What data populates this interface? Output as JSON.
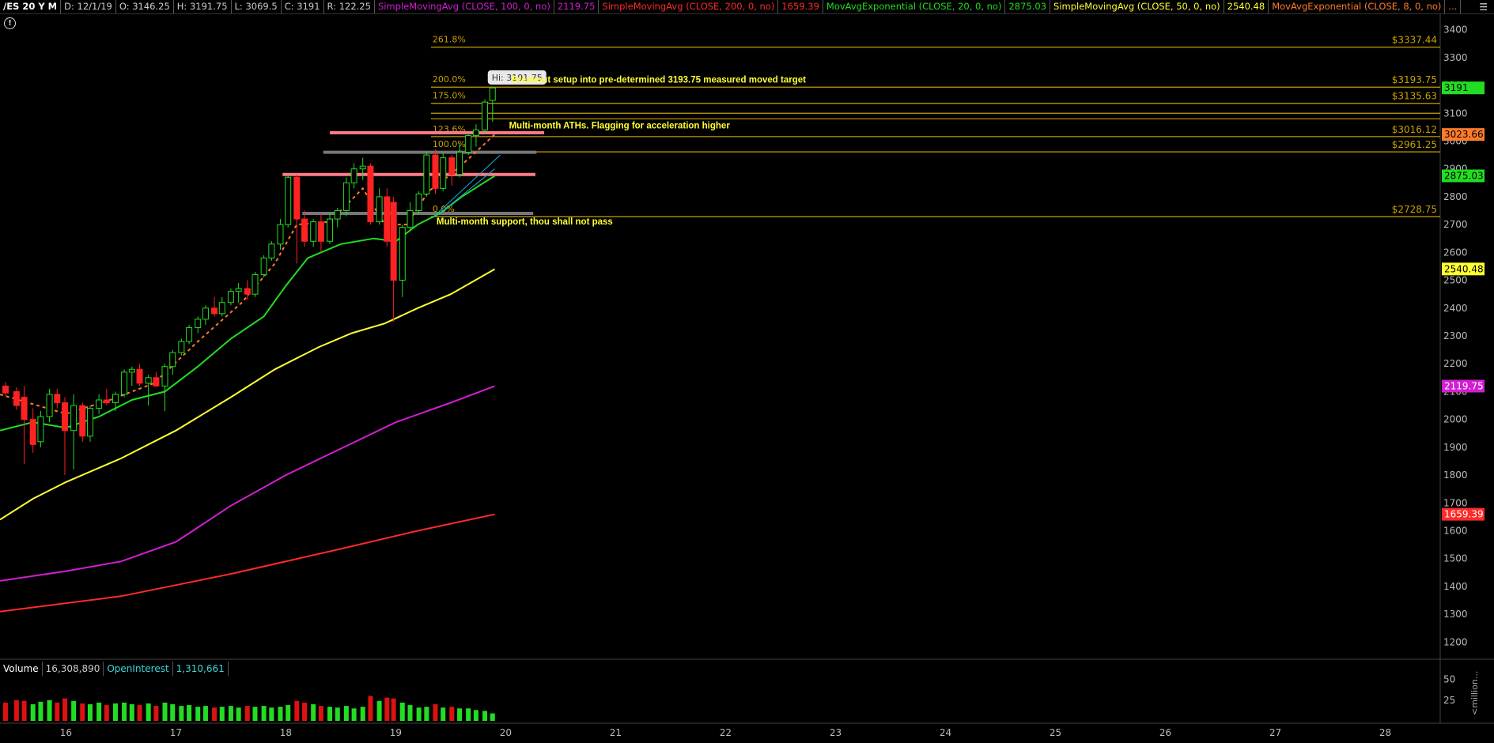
{
  "header": {
    "symbol": "/ES 20 Y M",
    "date": "D: 12/1/19",
    "open": "O: 3146.25",
    "high": "H: 3191.75",
    "low": "L: 3069.5",
    "close": "C: 3191",
    "range": "R: 122.25",
    "studies": [
      {
        "label": "SimpleMovingAvg (CLOSE, 100, 0, no)",
        "value": "2119.75",
        "color": "#d21fd2"
      },
      {
        "label": "SimpleMovingAvg (CLOSE, 200, 0, no)",
        "value": "1659.39",
        "color": "#ff2a2a"
      },
      {
        "label": "MovAvgExponential (CLOSE, 20, 0, no)",
        "value": "2875.03",
        "color": "#22dd22"
      },
      {
        "label": "SimpleMovingAvg (CLOSE, 50, 0, no)",
        "value": "2540.48",
        "color": "#ffff33"
      },
      {
        "label": "MovAvgExponential (CLOSE, 8, 0, no)",
        "value": "...",
        "color": "#ff7b2a"
      }
    ]
  },
  "icons": {
    "alert": "alert-circle-icon",
    "menu": "menu-icon"
  },
  "volume_header": {
    "volume_label": "Volume",
    "volume_value": "16,308,890",
    "oi_label": "OpenInterest",
    "oi_value": "1,310,661",
    "unit_label": "<million..."
  },
  "chart_data": {
    "type": "candlestick",
    "x_ticks": [
      "16",
      "17",
      "18",
      "19",
      "20",
      "21",
      "22",
      "23",
      "24",
      "25",
      "26",
      "27",
      "28"
    ],
    "y_ticks": [
      1200,
      1300,
      1400,
      1500,
      1600,
      1700,
      1800,
      1900,
      2000,
      2100,
      2200,
      2300,
      2400,
      2500,
      2600,
      2700,
      2800,
      2900,
      3000,
      3100,
      3200,
      3300,
      3400
    ],
    "ylim": [
      1150,
      3450
    ],
    "x_year_range": [
      15.4,
      28.5
    ],
    "volume_ticks": [
      25,
      50
    ],
    "hi_label": "Hi: 3191.75",
    "candles": [
      {
        "x": 15.45,
        "o": 2120,
        "h": 2135,
        "l": 2085,
        "c": 2095
      },
      {
        "x": 15.55,
        "o": 2100,
        "h": 2115,
        "l": 2035,
        "c": 2050
      },
      {
        "x": 15.62,
        "o": 2080,
        "h": 2120,
        "l": 1840,
        "c": 2000
      },
      {
        "x": 15.7,
        "o": 2000,
        "h": 2040,
        "l": 1880,
        "c": 1910
      },
      {
        "x": 15.77,
        "o": 1920,
        "h": 2030,
        "l": 1900,
        "c": 2010
      },
      {
        "x": 15.85,
        "o": 2010,
        "h": 2110,
        "l": 1990,
        "c": 2090
      },
      {
        "x": 15.92,
        "o": 2090,
        "h": 2110,
        "l": 2040,
        "c": 2060
      },
      {
        "x": 15.99,
        "o": 2060,
        "h": 2080,
        "l": 1800,
        "c": 1960
      },
      {
        "x": 16.07,
        "o": 1960,
        "h": 2090,
        "l": 1820,
        "c": 2050
      },
      {
        "x": 16.15,
        "o": 2050,
        "h": 2060,
        "l": 1920,
        "c": 1940
      },
      {
        "x": 16.22,
        "o": 1940,
        "h": 2050,
        "l": 1920,
        "c": 2040
      },
      {
        "x": 16.3,
        "o": 2040,
        "h": 2090,
        "l": 2020,
        "c": 2070
      },
      {
        "x": 16.37,
        "o": 2070,
        "h": 2110,
        "l": 2050,
        "c": 2060
      },
      {
        "x": 16.45,
        "o": 2060,
        "h": 2100,
        "l": 2030,
        "c": 2090
      },
      {
        "x": 16.53,
        "o": 2090,
        "h": 2180,
        "l": 2080,
        "c": 2170
      },
      {
        "x": 16.6,
        "o": 2170,
        "h": 2190,
        "l": 2120,
        "c": 2180
      },
      {
        "x": 16.67,
        "o": 2180,
        "h": 2200,
        "l": 2120,
        "c": 2130
      },
      {
        "x": 16.75,
        "o": 2130,
        "h": 2160,
        "l": 2050,
        "c": 2150
      },
      {
        "x": 16.82,
        "o": 2150,
        "h": 2170,
        "l": 2120,
        "c": 2120
      },
      {
        "x": 16.9,
        "o": 2120,
        "h": 2200,
        "l": 2030,
        "c": 2190
      },
      {
        "x": 16.97,
        "o": 2190,
        "h": 2250,
        "l": 2160,
        "c": 2240
      },
      {
        "x": 17.05,
        "o": 2240,
        "h": 2290,
        "l": 2230,
        "c": 2280
      },
      {
        "x": 17.12,
        "o": 2280,
        "h": 2340,
        "l": 2270,
        "c": 2330
      },
      {
        "x": 17.2,
        "o": 2330,
        "h": 2370,
        "l": 2310,
        "c": 2360
      },
      {
        "x": 17.27,
        "o": 2360,
        "h": 2410,
        "l": 2340,
        "c": 2400
      },
      {
        "x": 17.35,
        "o": 2400,
        "h": 2440,
        "l": 2370,
        "c": 2380
      },
      {
        "x": 17.42,
        "o": 2380,
        "h": 2440,
        "l": 2370,
        "c": 2420
      },
      {
        "x": 17.5,
        "o": 2420,
        "h": 2470,
        "l": 2410,
        "c": 2460
      },
      {
        "x": 17.57,
        "o": 2460,
        "h": 2490,
        "l": 2420,
        "c": 2470
      },
      {
        "x": 17.65,
        "o": 2470,
        "h": 2500,
        "l": 2430,
        "c": 2450
      },
      {
        "x": 17.72,
        "o": 2450,
        "h": 2530,
        "l": 2440,
        "c": 2520
      },
      {
        "x": 17.8,
        "o": 2520,
        "h": 2590,
        "l": 2510,
        "c": 2580
      },
      {
        "x": 17.87,
        "o": 2580,
        "h": 2640,
        "l": 2570,
        "c": 2630
      },
      {
        "x": 17.95,
        "o": 2630,
        "h": 2720,
        "l": 2610,
        "c": 2700
      },
      {
        "x": 18.02,
        "o": 2700,
        "h": 2880,
        "l": 2690,
        "c": 2870
      },
      {
        "x": 18.1,
        "o": 2870,
        "h": 2880,
        "l": 2560,
        "c": 2720
      },
      {
        "x": 18.17,
        "o": 2720,
        "h": 2750,
        "l": 2620,
        "c": 2640
      },
      {
        "x": 18.25,
        "o": 2640,
        "h": 2720,
        "l": 2620,
        "c": 2710
      },
      {
        "x": 18.32,
        "o": 2710,
        "h": 2740,
        "l": 2600,
        "c": 2640
      },
      {
        "x": 18.4,
        "o": 2640,
        "h": 2740,
        "l": 2630,
        "c": 2720
      },
      {
        "x": 18.47,
        "o": 2720,
        "h": 2760,
        "l": 2690,
        "c": 2750
      },
      {
        "x": 18.55,
        "o": 2750,
        "h": 2870,
        "l": 2730,
        "c": 2850
      },
      {
        "x": 18.62,
        "o": 2850,
        "h": 2920,
        "l": 2830,
        "c": 2900
      },
      {
        "x": 18.7,
        "o": 2900,
        "h": 2940,
        "l": 2860,
        "c": 2910
      },
      {
        "x": 18.77,
        "o": 2910,
        "h": 2920,
        "l": 2700,
        "c": 2710
      },
      {
        "x": 18.85,
        "o": 2710,
        "h": 2830,
        "l": 2700,
        "c": 2800
      },
      {
        "x": 18.92,
        "o": 2800,
        "h": 2830,
        "l": 2620,
        "c": 2640
      },
      {
        "x": 18.98,
        "o": 2780,
        "h": 2800,
        "l": 2350,
        "c": 2500
      },
      {
        "x": 19.06,
        "o": 2500,
        "h": 2700,
        "l": 2440,
        "c": 2690
      },
      {
        "x": 19.13,
        "o": 2690,
        "h": 2780,
        "l": 2680,
        "c": 2750
      },
      {
        "x": 19.21,
        "o": 2750,
        "h": 2820,
        "l": 2740,
        "c": 2810
      },
      {
        "x": 19.28,
        "o": 2810,
        "h": 2960,
        "l": 2800,
        "c": 2950
      },
      {
        "x": 19.36,
        "o": 2950,
        "h": 2970,
        "l": 2810,
        "c": 2830
      },
      {
        "x": 19.43,
        "o": 2830,
        "h": 2960,
        "l": 2820,
        "c": 2940
      },
      {
        "x": 19.51,
        "o": 2940,
        "h": 2950,
        "l": 2840,
        "c": 2880
      },
      {
        "x": 19.58,
        "o": 2880,
        "h": 2990,
        "l": 2870,
        "c": 2960
      },
      {
        "x": 19.66,
        "o": 2960,
        "h": 3030,
        "l": 2950,
        "c": 3020
      },
      {
        "x": 19.73,
        "o": 3020,
        "h": 3060,
        "l": 2980,
        "c": 3040
      },
      {
        "x": 19.81,
        "o": 3040,
        "h": 3150,
        "l": 3030,
        "c": 3140
      },
      {
        "x": 19.88,
        "o": 3146.25,
        "h": 3191.75,
        "l": 3069.5,
        "c": 3191
      }
    ],
    "volume": [
      {
        "x": 15.45,
        "v": 22,
        "up": false
      },
      {
        "x": 15.55,
        "v": 25,
        "up": false
      },
      {
        "x": 15.62,
        "v": 24,
        "up": false
      },
      {
        "x": 15.7,
        "v": 20,
        "up": true
      },
      {
        "x": 15.77,
        "v": 23,
        "up": true
      },
      {
        "x": 15.85,
        "v": 25,
        "up": true
      },
      {
        "x": 15.92,
        "v": 22,
        "up": false
      },
      {
        "x": 15.99,
        "v": 27,
        "up": false
      },
      {
        "x": 16.07,
        "v": 24,
        "up": true
      },
      {
        "x": 16.15,
        "v": 21,
        "up": false
      },
      {
        "x": 16.22,
        "v": 20,
        "up": true
      },
      {
        "x": 16.3,
        "v": 22,
        "up": true
      },
      {
        "x": 16.37,
        "v": 19,
        "up": false
      },
      {
        "x": 16.45,
        "v": 21,
        "up": true
      },
      {
        "x": 16.53,
        "v": 22,
        "up": true
      },
      {
        "x": 16.6,
        "v": 20,
        "up": true
      },
      {
        "x": 16.67,
        "v": 19,
        "up": false
      },
      {
        "x": 16.75,
        "v": 21,
        "up": true
      },
      {
        "x": 16.82,
        "v": 18,
        "up": false
      },
      {
        "x": 16.9,
        "v": 22,
        "up": true
      },
      {
        "x": 16.97,
        "v": 20,
        "up": true
      },
      {
        "x": 17.05,
        "v": 18,
        "up": true
      },
      {
        "x": 17.12,
        "v": 19,
        "up": true
      },
      {
        "x": 17.2,
        "v": 17,
        "up": true
      },
      {
        "x": 17.27,
        "v": 18,
        "up": true
      },
      {
        "x": 17.35,
        "v": 16,
        "up": false
      },
      {
        "x": 17.42,
        "v": 17,
        "up": true
      },
      {
        "x": 17.5,
        "v": 18,
        "up": true
      },
      {
        "x": 17.57,
        "v": 16,
        "up": true
      },
      {
        "x": 17.65,
        "v": 18,
        "up": false
      },
      {
        "x": 17.72,
        "v": 17,
        "up": true
      },
      {
        "x": 17.8,
        "v": 18,
        "up": true
      },
      {
        "x": 17.87,
        "v": 16,
        "up": true
      },
      {
        "x": 17.95,
        "v": 17,
        "up": true
      },
      {
        "x": 18.02,
        "v": 19,
        "up": true
      },
      {
        "x": 18.1,
        "v": 24,
        "up": false
      },
      {
        "x": 18.17,
        "v": 22,
        "up": false
      },
      {
        "x": 18.25,
        "v": 20,
        "up": true
      },
      {
        "x": 18.32,
        "v": 18,
        "up": false
      },
      {
        "x": 18.4,
        "v": 17,
        "up": true
      },
      {
        "x": 18.47,
        "v": 16,
        "up": true
      },
      {
        "x": 18.55,
        "v": 18,
        "up": true
      },
      {
        "x": 18.62,
        "v": 15,
        "up": true
      },
      {
        "x": 18.7,
        "v": 17,
        "up": true
      },
      {
        "x": 18.77,
        "v": 30,
        "up": false
      },
      {
        "x": 18.85,
        "v": 24,
        "up": true
      },
      {
        "x": 18.92,
        "v": 28,
        "up": false
      },
      {
        "x": 18.98,
        "v": 27,
        "up": false
      },
      {
        "x": 19.06,
        "v": 22,
        "up": true
      },
      {
        "x": 19.13,
        "v": 19,
        "up": true
      },
      {
        "x": 19.21,
        "v": 16,
        "up": true
      },
      {
        "x": 19.28,
        "v": 17,
        "up": true
      },
      {
        "x": 19.36,
        "v": 20,
        "up": false
      },
      {
        "x": 19.43,
        "v": 16,
        "up": true
      },
      {
        "x": 19.51,
        "v": 17,
        "up": false
      },
      {
        "x": 19.58,
        "v": 15,
        "up": true
      },
      {
        "x": 19.66,
        "v": 15,
        "up": true
      },
      {
        "x": 19.73,
        "v": 13,
        "up": true
      },
      {
        "x": 19.81,
        "v": 12,
        "up": true
      },
      {
        "x": 19.88,
        "v": 9,
        "up": true
      }
    ],
    "moving_averages": [
      {
        "color": "#ff2a2a",
        "style": "solid",
        "points": [
          [
            15.4,
            1310
          ],
          [
            16.5,
            1365
          ],
          [
            17.5,
            1445
          ],
          [
            18.5,
            1535
          ],
          [
            19.2,
            1600
          ],
          [
            19.9,
            1659
          ]
        ]
      },
      {
        "color": "#d21fd2",
        "style": "solid",
        "points": [
          [
            15.4,
            1420
          ],
          [
            16,
            1455
          ],
          [
            16.5,
            1490
          ],
          [
            17,
            1560
          ],
          [
            17.5,
            1690
          ],
          [
            18,
            1800
          ],
          [
            18.5,
            1895
          ],
          [
            19,
            1990
          ],
          [
            19.5,
            2060
          ],
          [
            19.9,
            2120
          ]
        ]
      },
      {
        "color": "#ffff33",
        "style": "solid",
        "points": [
          [
            15.4,
            1640
          ],
          [
            15.7,
            1715
          ],
          [
            16,
            1775
          ],
          [
            16.5,
            1860
          ],
          [
            17,
            1960
          ],
          [
            17.5,
            2080
          ],
          [
            17.9,
            2180
          ],
          [
            18.3,
            2260
          ],
          [
            18.6,
            2310
          ],
          [
            18.9,
            2345
          ],
          [
            19.2,
            2400
          ],
          [
            19.5,
            2450
          ],
          [
            19.9,
            2540
          ]
        ]
      },
      {
        "color": "#22dd22",
        "style": "solid",
        "points": [
          [
            15.4,
            1960
          ],
          [
            15.7,
            1990
          ],
          [
            16,
            1970
          ],
          [
            16.3,
            2010
          ],
          [
            16.6,
            2070
          ],
          [
            16.9,
            2100
          ],
          [
            17.2,
            2190
          ],
          [
            17.5,
            2290
          ],
          [
            17.8,
            2370
          ],
          [
            18,
            2480
          ],
          [
            18.2,
            2580
          ],
          [
            18.5,
            2630
          ],
          [
            18.8,
            2650
          ],
          [
            19,
            2640
          ],
          [
            19.2,
            2700
          ],
          [
            19.4,
            2740
          ],
          [
            19.6,
            2800
          ],
          [
            19.9,
            2875
          ]
        ]
      },
      {
        "color": "#ff7b2a",
        "style": "dashed",
        "points": [
          [
            15.4,
            2090
          ],
          [
            16,
            2020
          ],
          [
            16.4,
            2070
          ],
          [
            16.8,
            2130
          ],
          [
            17.2,
            2280
          ],
          [
            17.6,
            2420
          ],
          [
            17.9,
            2560
          ],
          [
            18.1,
            2700
          ],
          [
            18.4,
            2710
          ],
          [
            18.7,
            2830
          ],
          [
            18.9,
            2700
          ],
          [
            19.1,
            2700
          ],
          [
            19.3,
            2820
          ],
          [
            19.5,
            2880
          ],
          [
            19.7,
            2950
          ],
          [
            19.9,
            3024
          ]
        ]
      }
    ],
    "channel_lines": [
      {
        "color": "#22aadd",
        "x1": 19.35,
        "y1": 2730,
        "x2": 19.95,
        "y2": 2950
      },
      {
        "color": "#22aadd",
        "x1": 19.4,
        "y1": 2740,
        "x2": 19.9,
        "y2": 2900
      }
    ],
    "fib_levels": [
      {
        "pct": "261.8%",
        "price": 3337.44,
        "label": "$3337.44"
      },
      {
        "pct": "200.0%",
        "price": 3193.75,
        "label": "$3193.75"
      },
      {
        "pct": "175.0%",
        "price": 3135.63,
        "label": "$3135.63"
      },
      {
        "pct": "",
        "price": 3100,
        "label": ""
      },
      {
        "pct": "",
        "price": 3080,
        "label": ""
      },
      {
        "pct": "123.6%",
        "price": 3016.12,
        "label": "$3016.12"
      },
      {
        "pct": "100.0%",
        "price": 2961.25,
        "label": "$2961.25"
      },
      {
        "pct": "0.0%",
        "price": 2728.75,
        "label": "$2728.75"
      }
    ],
    "zones": [
      {
        "color": "#ff7b8a",
        "x1": 18.4,
        "x2": 20.35,
        "price": 3030
      },
      {
        "color": "#ff7b8a",
        "x1": 17.97,
        "x2": 20.27,
        "price": 2880
      },
      {
        "color": "#777777",
        "x1": 18.34,
        "x2": 20.28,
        "price": 2960
      },
      {
        "color": "#777777",
        "x1": 18.15,
        "x2": 20.25,
        "price": 2740
      }
    ],
    "annotations": [
      {
        "text": "Breakout setup  into pre-determined 3193.75 measured moved target",
        "x": 20.05,
        "price": 3210
      },
      {
        "text": "Multi-month ATHs. Flagging for acceleration higher",
        "x": 20.03,
        "price": 3045
      },
      {
        "text": "Multi-month support, thou shall not pass",
        "x": 19.37,
        "price": 2700
      }
    ],
    "price_tags": [
      {
        "value": "3191",
        "price": 3191,
        "bg": "#22dd22",
        "fg": "#000"
      },
      {
        "value": "3023.66",
        "price": 3023.66,
        "bg": "#ff7b2a",
        "fg": "#000"
      },
      {
        "value": "2875.03",
        "price": 2875.03,
        "bg": "#22dd22",
        "fg": "#000"
      },
      {
        "value": "2540.48",
        "price": 2540.48,
        "bg": "#ffff33",
        "fg": "#000"
      },
      {
        "value": "2119.75",
        "price": 2119.75,
        "bg": "#d21fd2",
        "fg": "#fff"
      },
      {
        "value": "1659.39",
        "price": 1659.39,
        "bg": "#ff2a2a",
        "fg": "#fff"
      }
    ]
  }
}
